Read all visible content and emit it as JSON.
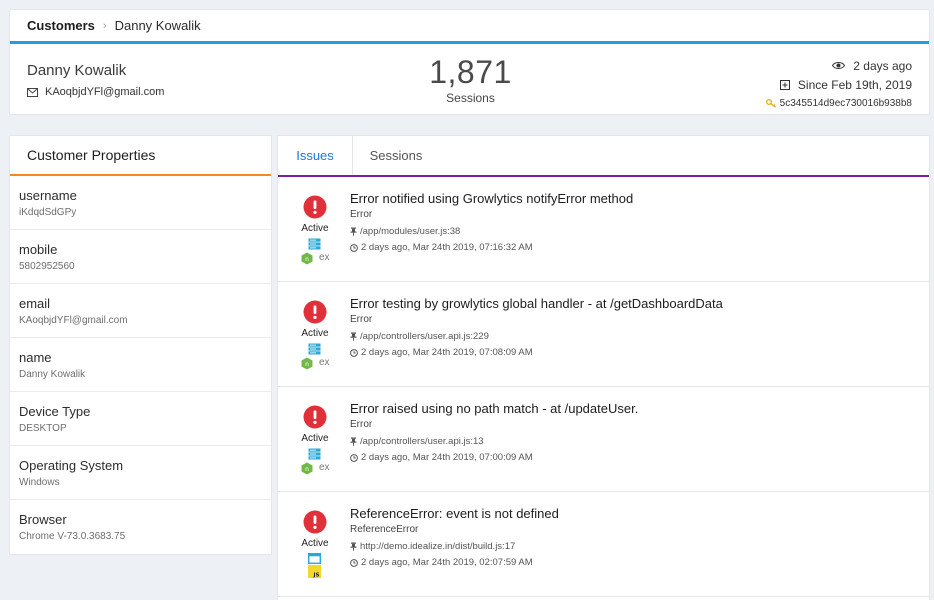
{
  "breadcrumb": {
    "root": "Customers",
    "current": "Danny Kowalik"
  },
  "customer": {
    "name": "Danny Kowalik",
    "email": "KAoqbjdYFl@gmail.com",
    "sessions_count": "1,871",
    "sessions_label": "Sessions",
    "last_seen": "2 days ago",
    "since": "Since Feb 19th, 2019",
    "id_key": "5c345514d9ec730016b938b8"
  },
  "properties": {
    "title": "Customer Properties",
    "items": [
      {
        "key": "username",
        "value": "iKdqdSdGPy"
      },
      {
        "key": "mobile",
        "value": "5802952560"
      },
      {
        "key": "email",
        "value": "KAoqbjdYFl@gmail.com"
      },
      {
        "key": "name",
        "value": "Danny Kowalik"
      },
      {
        "key": "Device Type",
        "value": "DESKTOP"
      },
      {
        "key": "Operating System",
        "value": "Windows"
      },
      {
        "key": "Browser",
        "value": "Chrome V-73.0.3683.75"
      }
    ]
  },
  "tabs": {
    "issues": "Issues",
    "sessions": "Sessions"
  },
  "issues": [
    {
      "title": "Error notified using Growlytics notifyError method",
      "type": "Error",
      "path": "/app/modules/user.js:38",
      "time": "2 days ago, Mar 24th 2019, 07:16:32 AM",
      "status": "Active",
      "platform": "node",
      "platform_label": "ex"
    },
    {
      "title": "Error testing by growlytics global handler - at /getDashboardData",
      "type": "Error",
      "path": "/app/controllers/user.api.js:229",
      "time": "2 days ago, Mar 24th 2019, 07:08:09 AM",
      "status": "Active",
      "platform": "node",
      "platform_label": "ex"
    },
    {
      "title": "Error raised using no path match - at /updateUser.",
      "type": "Error",
      "path": "/app/controllers/user.api.js:13",
      "time": "2 days ago, Mar 24th 2019, 07:00:09 AM",
      "status": "Active",
      "platform": "node",
      "platform_label": "ex"
    },
    {
      "title": "ReferenceError: event is not defined",
      "type": "ReferenceError",
      "path": "http://demo.idealize.in/dist/build.js:17",
      "time": "2 days ago, Mar 24th 2019, 02:07:59 AM",
      "status": "Active",
      "platform": "browser",
      "platform_label": ""
    }
  ],
  "colors": {
    "accent_blue": "#1e9be9",
    "accent_orange": "#f5891e",
    "accent_purple": "#7a1fa2",
    "error_red": "#e0303a"
  }
}
